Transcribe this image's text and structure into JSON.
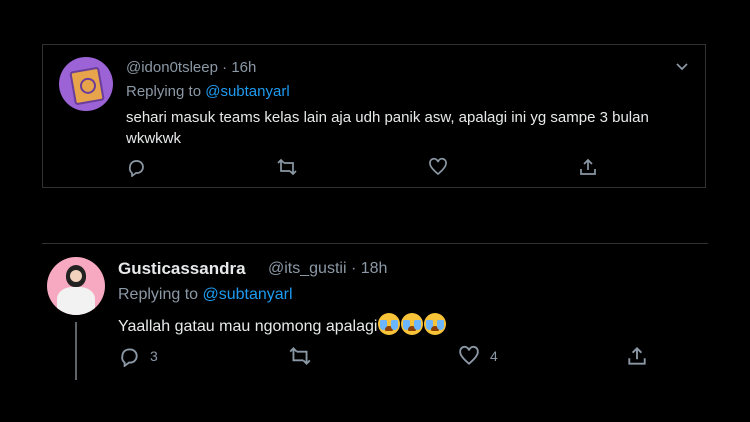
{
  "tweet1": {
    "handle": "@idon0tsleep",
    "separator": " · ",
    "time": "16h",
    "replying_prefix": "Replying to ",
    "replying_to": "@subtanyarl",
    "text": "sehari masuk teams kelas lain aja udh panik asw, apalagi ini yg sampe 3 bulan wkwkwk",
    "icons": [
      "reply-icon",
      "retweet-icon",
      "like-icon",
      "share-icon"
    ],
    "counts": {
      "reply": "",
      "retweet": "",
      "like": ""
    }
  },
  "tweet2": {
    "display_name": "Gusticassandra",
    "handle": "@its_gustii",
    "separator": " · ",
    "time": "18h",
    "replying_prefix": "Replying to ",
    "replying_to": "@subtanyarl",
    "text": "Yaallah gatau mau ngomong apalagi",
    "emoji_count": 3,
    "icons": [
      "reply-icon",
      "retweet-icon",
      "like-icon",
      "share-icon"
    ],
    "counts": {
      "reply": "3",
      "retweet": "",
      "like": "4"
    }
  },
  "colors": {
    "background": "#000000",
    "link": "#1d9bf0",
    "muted": "#8b98a5",
    "text": "#e7e9ea",
    "border": "#2f3336"
  }
}
